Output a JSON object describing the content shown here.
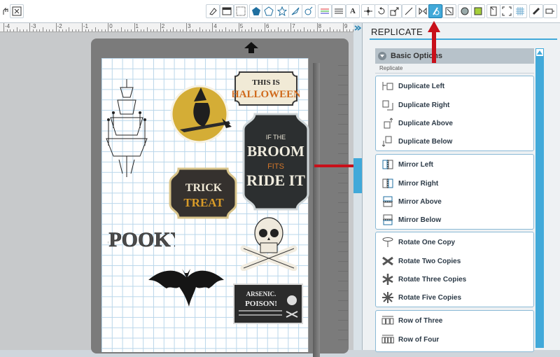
{
  "panel": {
    "title": "REPLICATE",
    "section": "Basic Options",
    "subheader": "Replicate",
    "groups": [
      {
        "items": [
          {
            "label": "Duplicate Left",
            "icon": "duplicate-left-icon"
          },
          {
            "label": "Duplicate Right",
            "icon": "duplicate-right-icon"
          },
          {
            "label": "Duplicate Above",
            "icon": "duplicate-above-icon"
          },
          {
            "label": "Duplicate Below",
            "icon": "duplicate-below-icon"
          }
        ]
      },
      {
        "items": [
          {
            "label": "Mirror Left",
            "icon": "mirror-left-icon"
          },
          {
            "label": "Mirror Right",
            "icon": "mirror-right-icon"
          },
          {
            "label": "Mirror Above",
            "icon": "mirror-above-icon"
          },
          {
            "label": "Mirror Below",
            "icon": "mirror-below-icon"
          }
        ]
      },
      {
        "items": [
          {
            "label": "Rotate One Copy",
            "icon": "rotate-one-icon"
          },
          {
            "label": "Rotate Two Copies",
            "icon": "rotate-two-icon"
          },
          {
            "label": "Rotate Three Copies",
            "icon": "rotate-three-icon"
          },
          {
            "label": "Rotate Five Copies",
            "icon": "rotate-five-icon"
          }
        ]
      },
      {
        "items": [
          {
            "label": "Row of Three",
            "icon": "row-three-icon"
          },
          {
            "label": "Row of Four",
            "icon": "row-four-icon"
          }
        ]
      }
    ]
  },
  "ruler": {
    "labels": [
      "-4",
      "-3",
      "-2",
      "-1",
      "0",
      "1",
      "2",
      "3",
      "4",
      "5",
      "6",
      "7",
      "8",
      "9"
    ]
  },
  "toolbar": {
    "text_tool_label": "A"
  },
  "artwork": {
    "halloween_sign": "THIS IS HALLOWEEN",
    "broom_sign": "IF THE BROOM FITS RIDE IT",
    "trick_sign": "TRICK or TREAT",
    "spooky": "SPOOKY",
    "poison_label": "ARSENIC POISON!"
  },
  "colors": {
    "accent": "#41a9d9",
    "annotation_arrow": "#c8101a"
  }
}
